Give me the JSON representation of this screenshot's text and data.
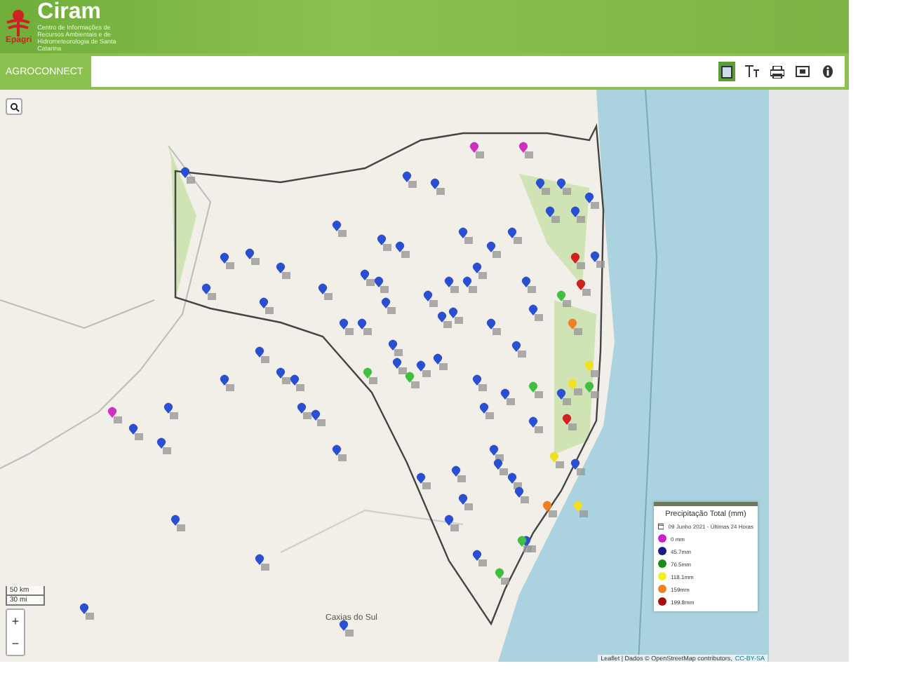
{
  "header": {
    "brand": "Ciram",
    "subtitle": "Centro de Informações de Recursos Ambientais e de Hidrometeorologia de Santa Catarina",
    "org": "Epagri",
    "app": "AGROCONNECT"
  },
  "toolbar": {
    "tools": [
      {
        "kind": "map",
        "selected": true
      },
      {
        "kind": "text",
        "selected": false
      },
      {
        "kind": "print",
        "selected": false
      },
      {
        "kind": "screen",
        "selected": false
      },
      {
        "kind": "info",
        "selected": false
      }
    ]
  },
  "map": {
    "place": "Caxias do Sul",
    "scale": [
      "50 km",
      "30 mi"
    ],
    "zoom": [
      "+",
      "−"
    ],
    "attribution_prefix": "Leaflet | Dados © OpenStreetMap contributors,",
    "attribution_link": "CC-BY-SA"
  },
  "legend": {
    "title": "Precipitação Total (mm)",
    "date": "09 Junho 2021 - Últimas 24 Horas",
    "items": [
      {
        "label": "0 mm",
        "color": "#cc22cc"
      },
      {
        "label": "45.7mm",
        "color": "#1a1a8a"
      },
      {
        "label": "76.5mm",
        "color": "#1a8a1a"
      },
      {
        "label": "118.1mm",
        "color": "#f0f020"
      },
      {
        "label": "159mm",
        "color": "#f08020"
      },
      {
        "label": "199.8mm",
        "color": "#a01010"
      }
    ]
  }
}
